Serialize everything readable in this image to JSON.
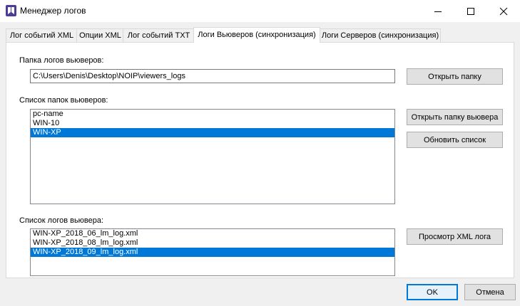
{
  "window": {
    "title": "Менеджер логов",
    "controls": {
      "minimize_icon": "minimize-icon",
      "maximize_icon": "maximize-icon",
      "close_icon": "close-icon"
    }
  },
  "tabs": [
    {
      "label": "Лог событий XML",
      "active": false
    },
    {
      "label": "Опции XML",
      "active": false
    },
    {
      "label": "Лог событий TXT",
      "active": false
    },
    {
      "label": "Логи Вьюверов (синхронизация)",
      "active": true
    },
    {
      "label": "Логи Серверов (синхронизация)",
      "active": false
    }
  ],
  "folder": {
    "label": "Папка логов вьюверов:",
    "path": "C:\\Users\\Denis\\Desktop\\NOIP\\viewers_logs",
    "open_button": "Открыть папку"
  },
  "viewer_folders": {
    "label": "Список папок вьюверов:",
    "items": [
      {
        "text": "pc-name",
        "selected": false
      },
      {
        "text": "WIN-10",
        "selected": false
      },
      {
        "text": "WIN-XP",
        "selected": true
      }
    ],
    "open_viewer_button": "Открыть папку вьювера",
    "refresh_button": "Обновить список"
  },
  "viewer_logs": {
    "label": "Список логов вьювера:",
    "items": [
      {
        "text": "WIN-XP_2018_06_lm_log.xml",
        "selected": false
      },
      {
        "text": "WIN-XP_2018_08_lm_log.xml",
        "selected": false
      },
      {
        "text": "WIN-XP_2018_09_lm_log.xml",
        "selected": true
      }
    ],
    "view_button": "Просмотр XML лога"
  },
  "footer": {
    "ok": "OK",
    "cancel": "Отмена"
  },
  "colors": {
    "selection": "#0078d7",
    "window_bg": "#f0f0f0",
    "titlebar": "#ffffff",
    "app_icon": "#4b3b9a"
  }
}
